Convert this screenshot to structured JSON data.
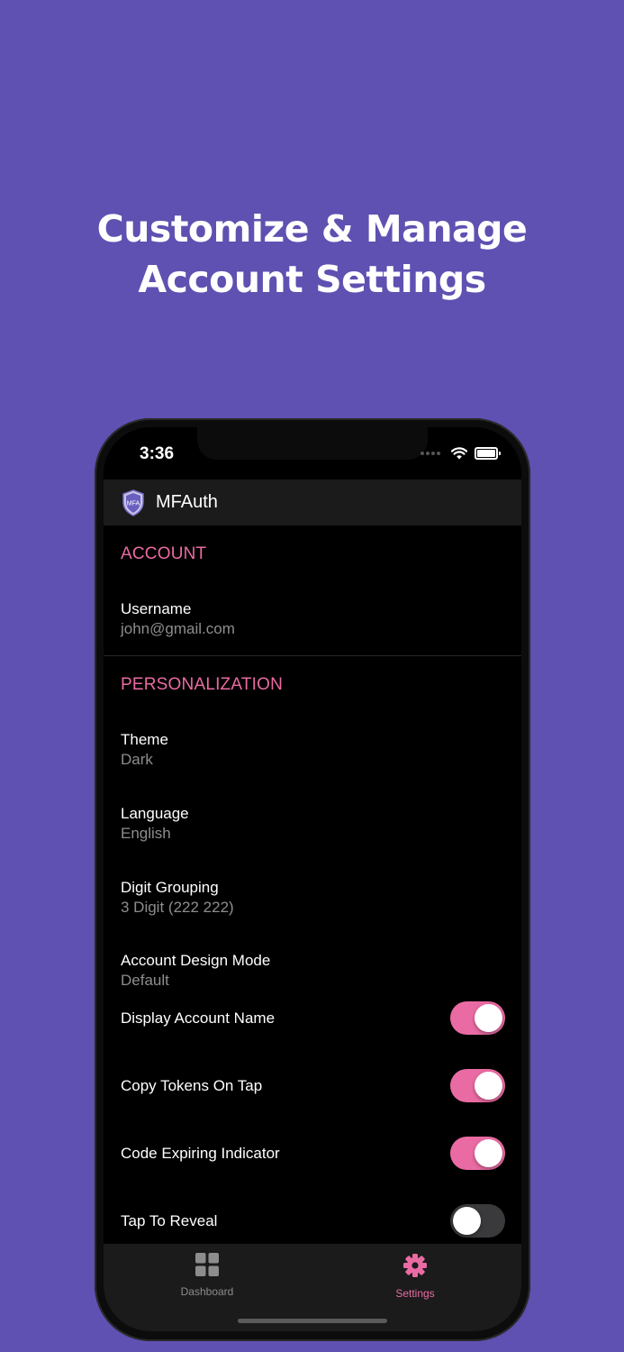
{
  "promo": {
    "line1": "Customize & Manage",
    "line2": "Account Settings",
    "background": "#5e51b1"
  },
  "status_bar": {
    "time": "3:36"
  },
  "app_bar": {
    "title": "MFAuth",
    "logo_text": "MFA",
    "logo_icon": "shield-icon"
  },
  "sections": {
    "account": {
      "header": "ACCOUNT",
      "username_label": "Username",
      "username_value": "john@gmail.com"
    },
    "personalization": {
      "header": "PERSONALIZATION",
      "theme_label": "Theme",
      "theme_value": "Dark",
      "language_label": "Language",
      "language_value": "English",
      "digit_grouping_label": "Digit Grouping",
      "digit_grouping_value": "3 Digit (222 222)",
      "design_mode_label": "Account Design Mode",
      "design_mode_value": "Default",
      "display_account_name_label": "Display Account Name",
      "display_account_name_on": true,
      "copy_tokens_label": "Copy Tokens On Tap",
      "copy_tokens_on": true,
      "code_expiring_label": "Code Expiring Indicator",
      "code_expiring_on": true,
      "tap_to_reveal_label": "Tap To Reveal",
      "tap_to_reveal_on": false
    }
  },
  "tab_bar": {
    "dashboard_label": "Dashboard",
    "dashboard_icon": "grid-icon",
    "settings_label": "Settings",
    "settings_icon": "gear-icon",
    "active_tab": "Settings"
  },
  "colors": {
    "accent": "#ea6ba3",
    "inactive_tab": "#8d8d8d",
    "app_bar": "#1b1b1b"
  }
}
